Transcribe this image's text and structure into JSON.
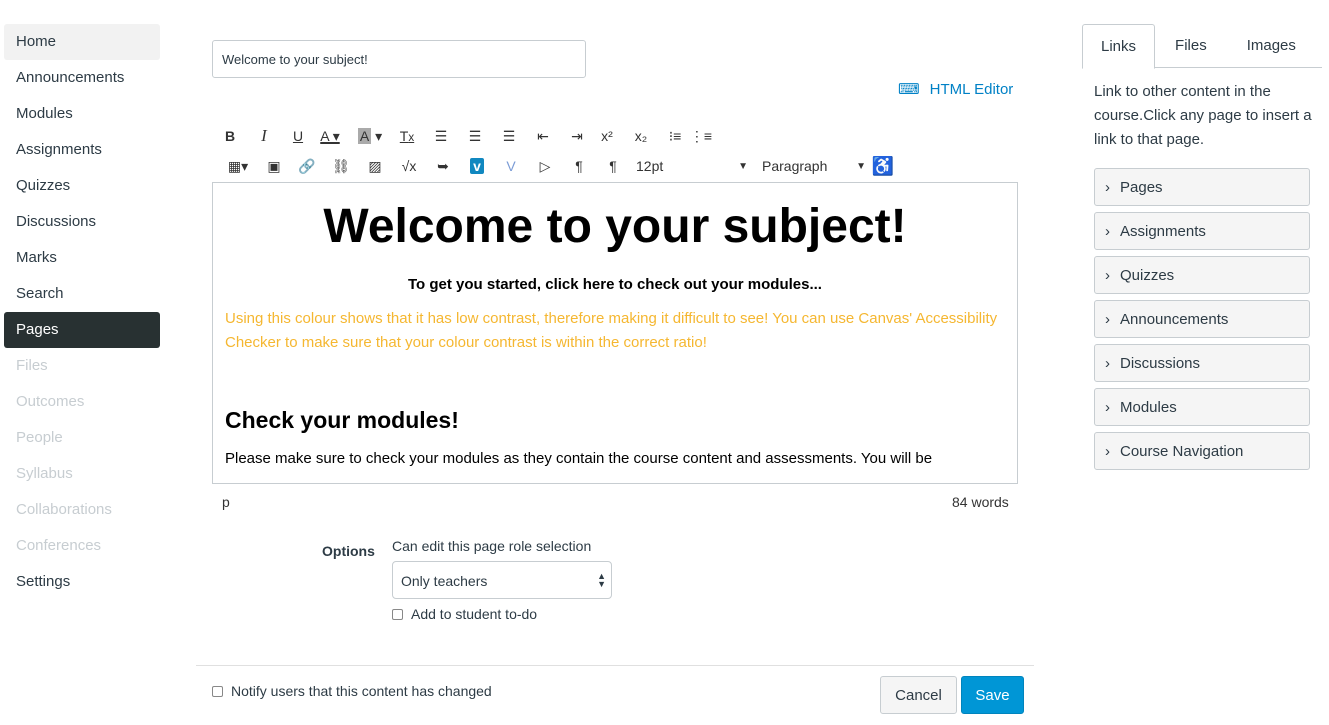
{
  "nav": [
    "Home",
    "Announcements",
    "Modules",
    "Assignments",
    "Quizzes",
    "Discussions",
    "Marks",
    "Search",
    "Pages",
    "Files",
    "Outcomes",
    "People",
    "Syllabus",
    "Collaborations",
    "Conferences",
    "Settings"
  ],
  "title_value": "Welcome to your subject!",
  "html_editor": "HTML Editor",
  "toolbar": {
    "font_size": "12pt",
    "block_format": "Paragraph"
  },
  "content": {
    "heading": "Welcome to your subject!",
    "subheading": "To get you started, click here to check out your modules...",
    "warning": "Using this colour shows that it has low contrast, therefore making it difficult to see! You can use Canvas' Accessibility Checker to make sure that your colour contrast is within the correct ratio!",
    "warning_color": "#f5b731",
    "h2": "Check your modules!",
    "body": "Please make sure to check your modules as they contain the course content and assessments. You will be"
  },
  "status": {
    "path": "p",
    "word_count": "84 words"
  },
  "options": {
    "label": "Options",
    "role_label": "Can edit this page role selection",
    "role_value": "Only teachers",
    "todo": "Add to student to-do"
  },
  "notify": "Notify users that this content has changed",
  "buttons": {
    "cancel": "Cancel",
    "save": "Save"
  },
  "side": {
    "tabs": [
      "Links",
      "Files",
      "Images"
    ],
    "text": "Link to other content in the course.Click any page to insert a link to that page.",
    "items": [
      "Pages",
      "Assignments",
      "Quizzes",
      "Announcements",
      "Discussions",
      "Modules",
      "Course Navigation"
    ]
  },
  "colors": {
    "accent": "#0096d6",
    "active_nav": "#283132"
  }
}
